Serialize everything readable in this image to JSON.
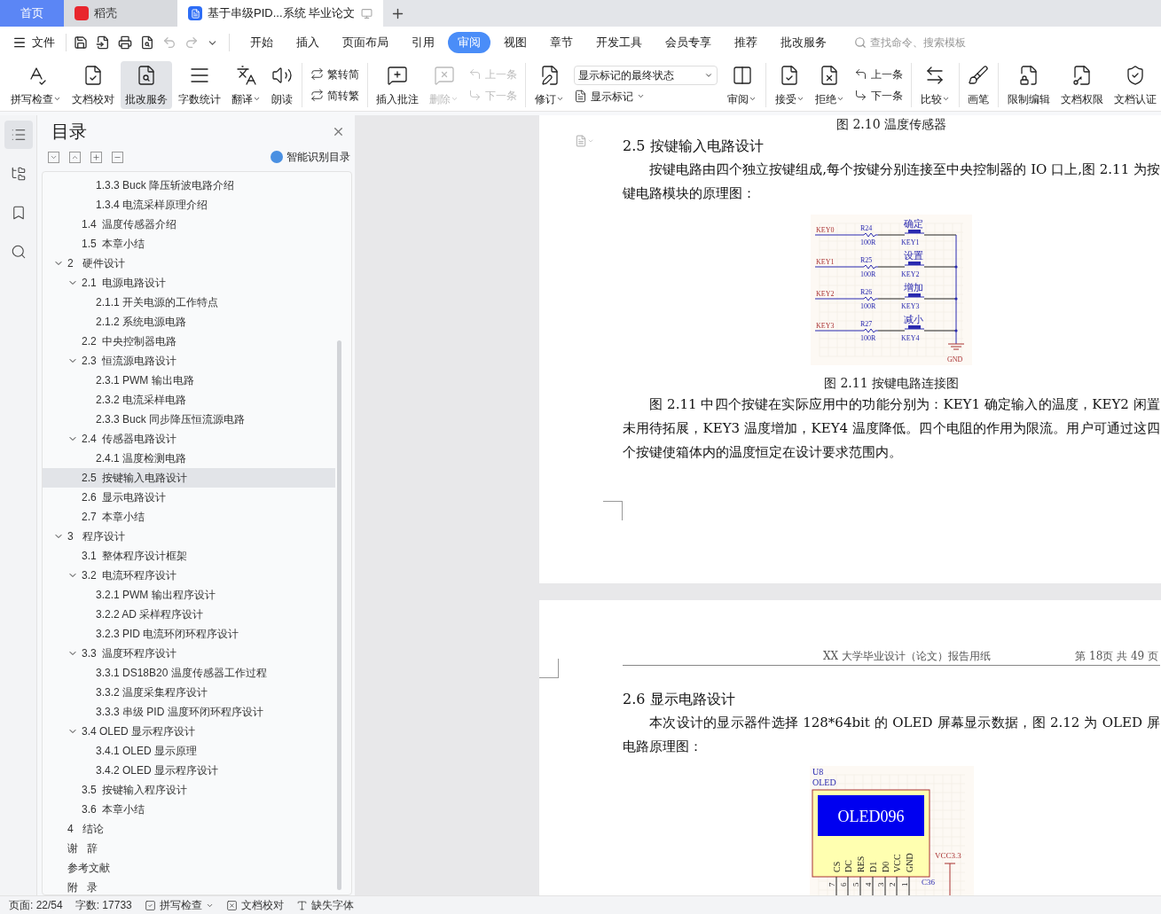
{
  "tabs": [
    {
      "kind": "home",
      "label": "首页",
      "selected": false
    },
    {
      "kind": "app",
      "label": "稻壳",
      "selected": false
    },
    {
      "kind": "doc",
      "label": "基于串级PID...系统 毕业论文",
      "selected": true
    }
  ],
  "menu": {
    "file": "文件",
    "tabs": [
      {
        "label": "开始",
        "selected": false
      },
      {
        "label": "插入",
        "selected": false
      },
      {
        "label": "页面布局",
        "selected": false
      },
      {
        "label": "引用",
        "selected": false
      },
      {
        "label": "审阅",
        "selected": true
      },
      {
        "label": "视图",
        "selected": false
      },
      {
        "label": "章节",
        "selected": false
      },
      {
        "label": "开发工具",
        "selected": false
      },
      {
        "label": "会员专享",
        "selected": false
      },
      {
        "label": "推荐",
        "selected": false
      },
      {
        "label": "批改服务",
        "selected": false
      }
    ],
    "search": {
      "placeholder": "查找命令、搜索模板"
    }
  },
  "ribbon": [
    [
      {
        "kind": "big",
        "label": "拼写检查",
        "dropdown": true,
        "pressed": false,
        "disabled": false
      },
      {
        "kind": "big",
        "label": "文档校对",
        "dropdown": false,
        "pressed": false,
        "disabled": false
      },
      {
        "kind": "big",
        "label": "批改服务",
        "dropdown": false,
        "pressed": true,
        "disabled": false
      },
      {
        "kind": "big",
        "label": "字数统计",
        "dropdown": false,
        "pressed": false,
        "disabled": false
      },
      {
        "kind": "big",
        "label": "翻译",
        "dropdown": true,
        "pressed": false,
        "disabled": false
      },
      {
        "kind": "big",
        "label": "朗读",
        "dropdown": false,
        "pressed": false,
        "disabled": false
      }
    ],
    [
      {
        "kind": "stack",
        "items": [
          {
            "label": "繁转简",
            "disabled": false
          },
          {
            "label": "简转繁",
            "disabled": false
          }
        ]
      }
    ],
    [
      {
        "kind": "big",
        "label": "插入批注",
        "dropdown": false,
        "pressed": false,
        "disabled": false
      },
      {
        "kind": "big",
        "label": "删除",
        "dropdown": true,
        "pressed": false,
        "disabled": true
      },
      {
        "kind": "stack",
        "items": [
          {
            "label": "上一条",
            "disabled": true
          },
          {
            "label": "下一条",
            "disabled": true
          }
        ]
      }
    ],
    [
      {
        "kind": "big",
        "label": "修订",
        "dropdown": true,
        "pressed": false,
        "disabled": false
      },
      {
        "kind": "select",
        "value": "显示标记的最终状态",
        "button": {
          "label": "显示标记",
          "dropdown": true
        }
      },
      {
        "kind": "big",
        "label": "审阅",
        "dropdown": true,
        "pressed": false,
        "disabled": false
      }
    ],
    [
      {
        "kind": "big",
        "label": "接受",
        "dropdown": true,
        "pressed": false,
        "disabled": false
      },
      {
        "kind": "big",
        "label": "拒绝",
        "dropdown": true,
        "pressed": false,
        "disabled": false
      },
      {
        "kind": "stack",
        "items": [
          {
            "label": "上一条",
            "disabled": false
          },
          {
            "label": "下一条",
            "disabled": false
          }
        ]
      }
    ],
    [
      {
        "kind": "big",
        "label": "比较",
        "dropdown": true,
        "pressed": false,
        "disabled": false
      }
    ],
    [
      {
        "kind": "big",
        "label": "画笔",
        "dropdown": false,
        "pressed": false,
        "disabled": false
      }
    ],
    [
      {
        "kind": "big",
        "label": "限制编辑",
        "dropdown": false,
        "pressed": false,
        "disabled": false
      },
      {
        "kind": "big",
        "label": "文档权限",
        "dropdown": false,
        "pressed": false,
        "disabled": false
      },
      {
        "kind": "big",
        "label": "文档认证",
        "dropdown": false,
        "pressed": false,
        "disabled": false
      }
    ]
  ],
  "side_rail": [
    {
      "selected": true
    },
    {
      "selected": false
    },
    {
      "selected": false
    },
    {
      "selected": false
    }
  ],
  "outline": {
    "title": "目录",
    "smart_button": "智能识别目录",
    "items": [
      {
        "children": [
          {
            "children": [
              {
                "label": "1.3.3 Buck 降压斩波电路介绍",
                "selected": false
              },
              {
                "label": "1.3.4 电流采样原理介绍",
                "selected": false
              }
            ]
          },
          {
            "label": "1.4  温度传感器介绍",
            "selected": false
          },
          {
            "label": "1.5  本章小结",
            "selected": false
          }
        ]
      },
      {
        "label": "2   硬件设计",
        "selected": false,
        "expanded": true,
        "children": [
          {
            "label": "2.1  电源电路设计",
            "selected": false,
            "expanded": true,
            "children": [
              {
                "label": "2.1.1 开关电源的工作特点",
                "selected": false
              },
              {
                "label": "2.1.2 系统电源电路",
                "selected": false
              }
            ]
          },
          {
            "label": "2.2  中央控制器电路",
            "selected": false
          },
          {
            "label": "2.3  恒流源电路设计",
            "selected": false,
            "expanded": true,
            "children": [
              {
                "label": "2.3.1 PWM 输出电路",
                "selected": false
              },
              {
                "label": "2.3.2 电流采样电路",
                "selected": false
              },
              {
                "label": "2.3.3 Buck 同步降压恒流源电路",
                "selected": false
              }
            ]
          },
          {
            "label": "2.4  传感器电路设计",
            "selected": false,
            "expanded": true,
            "children": [
              {
                "label": "2.4.1 温度检测电路",
                "selected": false
              }
            ]
          },
          {
            "label": "2.5  按键输入电路设计",
            "selected": true
          },
          {
            "label": "2.6  显示电路设计",
            "selected": false
          },
          {
            "label": "2.7  本章小结",
            "selected": false
          }
        ]
      },
      {
        "label": "3   程序设计",
        "selected": false,
        "expanded": true,
        "children": [
          {
            "label": "3.1  整体程序设计框架",
            "selected": false
          },
          {
            "label": "3.2  电流环程序设计",
            "selected": false,
            "expanded": true,
            "children": [
              {
                "label": "3.2.1 PWM 输出程序设计",
                "selected": false
              },
              {
                "label": "3.2.2 AD 采样程序设计",
                "selected": false
              },
              {
                "label": "3.2.3 PID 电流环闭环程序设计",
                "selected": false
              }
            ]
          },
          {
            "label": "3.3  温度环程序设计",
            "selected": false,
            "expanded": true,
            "children": [
              {
                "label": "3.3.1 DS18B20 温度传感器工作过程",
                "selected": false
              },
              {
                "label": "3.3.2 温度采集程序设计",
                "selected": false
              },
              {
                "label": "3.3.3 串级 PID 温度环闭环程序设计",
                "selected": false
              }
            ]
          },
          {
            "label": "3.4 OLED 显示程序设计",
            "selected": false,
            "expanded": true,
            "children": [
              {
                "label": "3.4.1 OLED 显示原理",
                "selected": false
              },
              {
                "label": "3.4.2 OLED 显示程序设计",
                "selected": false
              }
            ]
          },
          {
            "label": "3.5  按键输入程序设计",
            "selected": false
          },
          {
            "label": "3.6  本章小结",
            "selected": false
          }
        ]
      },
      {
        "label": "4   结论",
        "selected": false
      },
      {
        "label": "谢   辞",
        "selected": false
      },
      {
        "label": "参考文献",
        "selected": false
      },
      {
        "label": "附   录",
        "selected": false
      }
    ]
  },
  "document": {
    "pages": [
      {
        "blocks": [
          {
            "kind": "caption",
            "text": "图 2.10 温度传感器"
          },
          {
            "kind": "heading",
            "text": "2.5 按键输入电路设计"
          },
          {
            "kind": "paragraph",
            "text": "按键电路由四个独立按键组成,每个按键分别连接至中央控制器的 IO 口上,图 2.11 为按键电路模块的原理图："
          },
          {
            "kind": "key_schematic",
            "gnd": "GND",
            "rows": [
              {
                "net": "KEY0",
                "resistor": "R24",
                "value": "100R",
                "key": "KEY1",
                "function": "确定"
              },
              {
                "net": "KEY1",
                "resistor": "R25",
                "value": "100R",
                "key": "KEY2",
                "function": "设置"
              },
              {
                "net": "KEY2",
                "resistor": "R26",
                "value": "100R",
                "key": "KEY3",
                "function": "增加"
              },
              {
                "net": "KEY3",
                "resistor": "R27",
                "value": "100R",
                "key": "KEY4",
                "function": "减小"
              }
            ]
          },
          {
            "kind": "caption",
            "text": "图 2.11 按键电路连接图"
          },
          {
            "kind": "paragraph",
            "text": "图 2.11 中四个按键在实际应用中的功能分别为：KEY1 确定输入的温度，KEY2 闲置未用待拓展，KEY3 温度增加，KEY4 温度降低。四个电阻的作用为限流。用户可通过这四个按键使箱体内的温度恒定在设计要求范围内。"
          }
        ]
      },
      {
        "header": {
          "title": "XX 大学毕业设计（论文）报告用纸",
          "page": "第 18页 共 49 页"
        },
        "blocks": [
          {
            "kind": "heading",
            "text": "2.6 显示电路设计"
          },
          {
            "kind": "paragraph",
            "text": "本次设计的显示器件选择 128*64bit 的 OLED 屏幕显示数据，图 2.12 为 OLED 屏电路原理图："
          },
          {
            "kind": "oled_schematic",
            "ref": "U8",
            "part": "OLED",
            "screen": "OLED096",
            "supply": "VCC3.3",
            "capacitor": "C36",
            "pins": [
              {
                "name": "CS",
                "number": "7"
              },
              {
                "name": "DC",
                "number": "6"
              },
              {
                "name": "RES",
                "number": "5"
              },
              {
                "name": "D1",
                "number": "4"
              },
              {
                "name": "D0",
                "number": "3"
              },
              {
                "name": "VCC",
                "number": "2"
              },
              {
                "name": "GND",
                "number": "1"
              }
            ]
          }
        ]
      }
    ]
  },
  "status_bar": [
    {
      "kind": "text",
      "label": "页面: 22/54"
    },
    {
      "kind": "text",
      "label": "字数: 17733"
    },
    {
      "kind": "button",
      "label": "拼写检查",
      "dropdown": true
    },
    {
      "kind": "button",
      "label": "文档校对",
      "dropdown": false
    },
    {
      "kind": "button",
      "label": "缺失字体",
      "dropdown": false
    }
  ]
}
